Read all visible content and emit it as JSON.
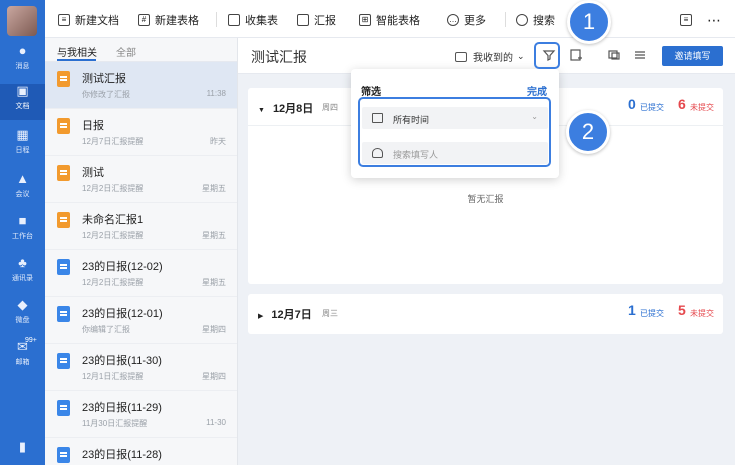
{
  "rail": {
    "items": [
      {
        "label": "消息",
        "icon": "chat-icon"
      },
      {
        "label": "文档",
        "icon": "docs-icon"
      },
      {
        "label": "日程",
        "icon": "calendar-icon"
      },
      {
        "label": "会议",
        "icon": "meeting-icon"
      },
      {
        "label": "工作台",
        "icon": "workbench-icon"
      },
      {
        "label": "通讯录",
        "icon": "contacts-icon"
      },
      {
        "label": "微盘",
        "icon": "drive-icon"
      },
      {
        "label": "邮箱",
        "icon": "mail-icon",
        "badge": "99+"
      }
    ]
  },
  "toolbar": {
    "new_doc": "新建文档",
    "new_sheet": "新建表格",
    "collect": "收集表",
    "report": "汇报",
    "smart_sheet": "智能表格",
    "more": "更多",
    "search": "搜索"
  },
  "list": {
    "tabs": [
      "与我相关",
      "全部"
    ],
    "items": [
      {
        "title": "测试汇报",
        "sub": "你修改了汇报",
        "time": "11:38",
        "color": "orange"
      },
      {
        "title": "日报",
        "sub": "12月7日汇报提醒",
        "time": "昨天",
        "color": "orange"
      },
      {
        "title": "测试",
        "sub": "12月2日汇报提醒",
        "time": "星期五",
        "color": "orange"
      },
      {
        "title": "未命名汇报1",
        "sub": "12月2日汇报提醒",
        "time": "星期五",
        "color": "orange"
      },
      {
        "title": "23的日报(12-02)",
        "sub": "12月2日汇报提醒",
        "time": "星期五",
        "color": "blue"
      },
      {
        "title": "23的日报(12-01)",
        "sub": "你编辑了汇报",
        "time": "星期四",
        "color": "blue"
      },
      {
        "title": "23的日报(11-30)",
        "sub": "12月1日汇报提醒",
        "time": "星期四",
        "color": "blue"
      },
      {
        "title": "23的日报(11-29)",
        "sub": "11月30日汇报提醒",
        "time": "11-30",
        "color": "blue"
      },
      {
        "title": "23的日报(11-28)",
        "sub": "",
        "time": "",
        "color": "blue"
      }
    ]
  },
  "main": {
    "title": "测试汇报",
    "received": "我收到的",
    "invite": "邀请填写",
    "cards": [
      {
        "date": "12月8日",
        "weekday": "周四",
        "submitted": "0",
        "submitted_label": "已提交",
        "unsubmitted": "6",
        "unsubmitted_label": "未提交",
        "empty": "暂无汇报"
      },
      {
        "date": "12月7日",
        "weekday": "周三",
        "submitted": "1",
        "submitted_label": "已提交",
        "unsubmitted": "5",
        "unsubmitted_label": "未提交"
      }
    ]
  },
  "filter": {
    "title": "筛选",
    "done": "完成",
    "time_value": "所有时间",
    "search_placeholder": "搜索填写人"
  },
  "markers": [
    "1",
    "2"
  ],
  "colors": {
    "accent": "#2b6fd0",
    "red": "#e5484d",
    "orange": "#f29a2e"
  }
}
